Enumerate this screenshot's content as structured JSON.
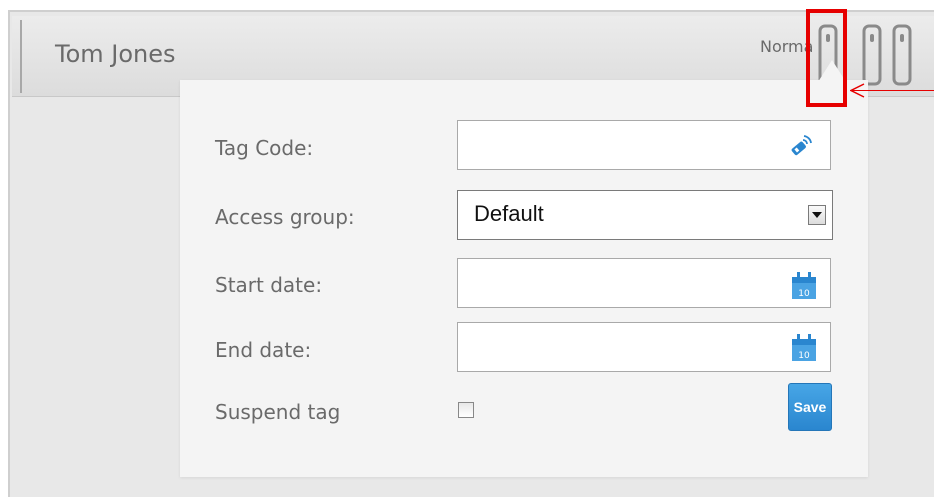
{
  "person": {
    "name": "Tom Jones",
    "status": "Normal"
  },
  "form": {
    "tag_code_label": "Tag Code:",
    "tag_code_value": "",
    "access_group_label": "Access group:",
    "access_group_value": "Default",
    "start_date_label": "Start date:",
    "start_date_value": "",
    "end_date_label": "End date:",
    "end_date_value": "",
    "calendar_day": "10",
    "suspend_label": "Suspend tag",
    "suspend_checked": false,
    "save_label": "Save"
  },
  "icons": {
    "tag_reader": "rfid-reader-icon",
    "calendar": "calendar-icon",
    "tag_slot": "tag-icon"
  },
  "colors": {
    "accent": "#2a86cf",
    "highlight": "#e60000",
    "label_text": "#6a6a6a"
  }
}
